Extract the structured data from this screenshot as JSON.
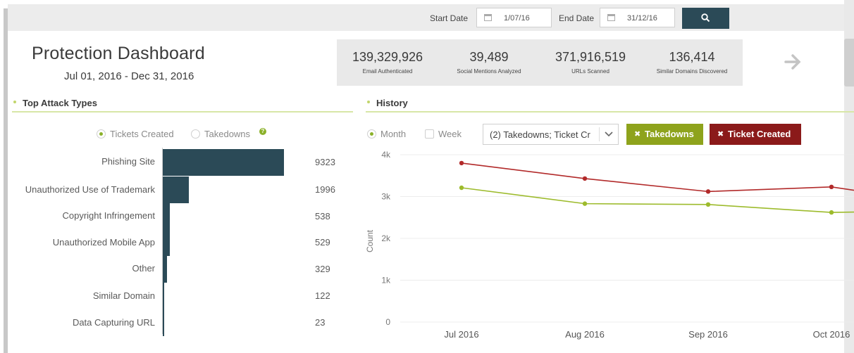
{
  "filters": {
    "start_date_label": "Start Date",
    "start_date_value": "1/07/16",
    "end_date_label": "End Date",
    "end_date_value": "31/12/16",
    "search_icon": "search-icon"
  },
  "header": {
    "title": "Protection Dashboard",
    "date_range": "Jul 01, 2016 - Dec 31, 2016"
  },
  "stats": [
    {
      "value": "139,329,926",
      "label": "Email Authenticated"
    },
    {
      "value": "39,489",
      "label": "Social Mentions Analyzed"
    },
    {
      "value": "371,916,519",
      "label": "URLs Scanned"
    },
    {
      "value": "136,414",
      "label": "Similar Domains Discovered"
    }
  ],
  "attack_types": {
    "section_title": "Top Attack Types",
    "radio_tickets": "Tickets Created",
    "radio_takedowns": "Takedowns",
    "selected": "Tickets Created",
    "help_icon": "?",
    "bars": [
      {
        "label": "Phishing Site",
        "value": 9323
      },
      {
        "label": "Unauthorized Use of Trademark",
        "value": 1996
      },
      {
        "label": "Copyright Infringement",
        "value": 538
      },
      {
        "label": "Unauthorized Mobile App",
        "value": 529
      },
      {
        "label": "Other",
        "value": 329
      },
      {
        "label": "Similar Domain",
        "value": 122
      },
      {
        "label": "Data Capturing URL",
        "value": 23
      }
    ]
  },
  "history": {
    "section_title": "History",
    "radio_month": "Month",
    "radio_week": "Week",
    "selected": "Month",
    "select_value": "(2) Takedowns; Ticket Cr",
    "btn_takedowns": "Takedowns",
    "btn_ticket_created": "Ticket Created",
    "btn_takedowns_color": "#8ea31c",
    "btn_ticket_created_color": "#8b1a1a"
  },
  "chart_data": {
    "type": "line",
    "ylabel": "Count",
    "x": [
      "Jul 2016",
      "Aug 2016",
      "Sep 2016",
      "Oct 2016"
    ],
    "y_ticks": [
      "0",
      "1k",
      "2k",
      "3k",
      "4k"
    ],
    "ylim": [
      0,
      4000
    ],
    "grid": true,
    "series": [
      {
        "name": "Ticket Created",
        "color": "#b22a2a",
        "values": [
          3800,
          3430,
          3120,
          3230
        ]
      },
      {
        "name": "Takedowns",
        "color": "#9dbb2c",
        "values": [
          3210,
          2830,
          2810,
          2620
        ]
      }
    ]
  }
}
